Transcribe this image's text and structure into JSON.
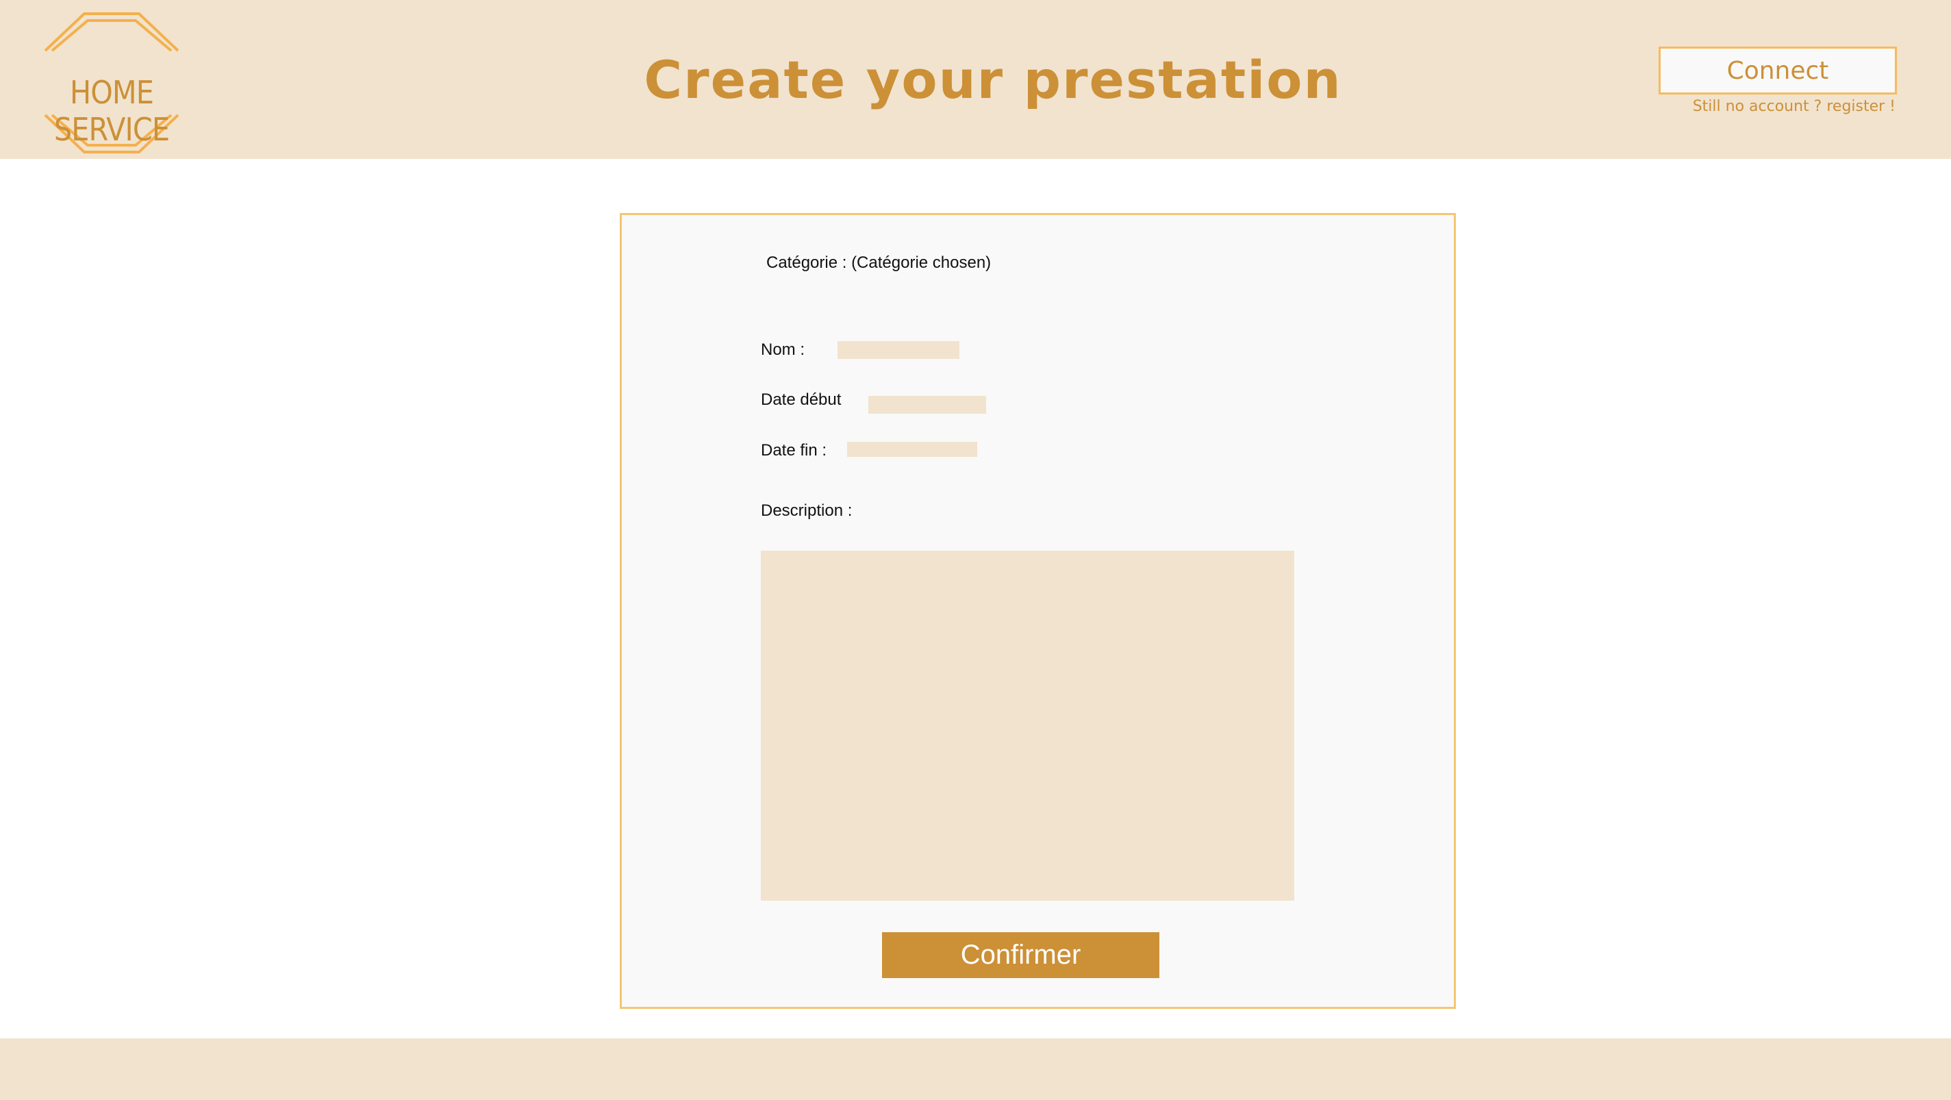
{
  "header": {
    "logo_text": "HOME SERVICE",
    "title": "Create your prestation",
    "connect_label": "Connect",
    "register_text": "Still no account ? register !"
  },
  "form": {
    "category_text": "Catégorie : (Catégorie chosen)",
    "nom_label": "Nom :",
    "nom_value": "",
    "date_debut_label": "Date début",
    "date_debut_value": "",
    "date_fin_label": "Date fin :",
    "date_fin_value": "",
    "description_label": "Description :",
    "description_value": "",
    "confirm_label": "Confirmer"
  },
  "colors": {
    "header_bg": "#f1e3ce",
    "accent": "#cc9037",
    "border": "#f5c670",
    "card_bg": "#f9f9f9"
  }
}
